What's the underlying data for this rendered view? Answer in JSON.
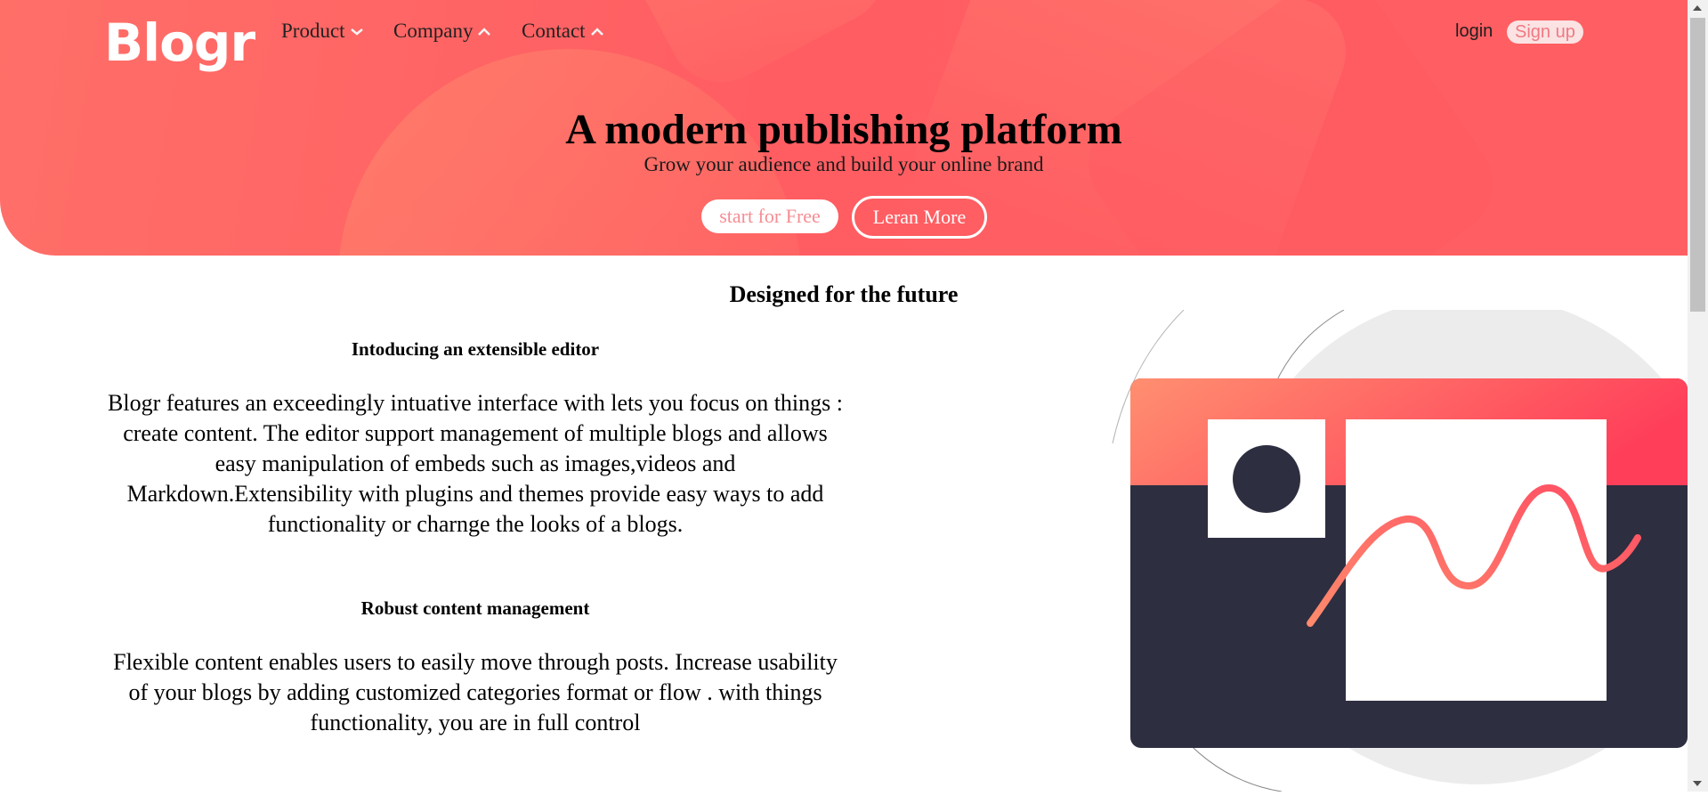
{
  "brand": {
    "logo": "Blogr"
  },
  "nav": {
    "product": "Product",
    "company": "Company",
    "contact": "Contact"
  },
  "auth": {
    "login": "login",
    "signup": "Sign up"
  },
  "hero": {
    "title": "A modern publishing platform",
    "subtitle": "Grow your audience and build your online brand",
    "primary_button": "start for Free",
    "secondary_button": "Leran More"
  },
  "section": {
    "title": "Designed for the future",
    "features": [
      {
        "heading": "Intoducing an extensible editor",
        "text": "Blogr features an exceedingly intuative interface with lets you focus on things : create content. The editor support management of multiple blogs and allows easy manipulation of embeds such as images,videos and Markdown.Extensibility with plugins and themes provide easy ways to add functionality or charnge the looks of a blogs."
      },
      {
        "heading": "Robust content management",
        "text": "Flexible content enables users to easily move through posts. Increase usability of your blogs by adding customized categories format or flow . with things functionality, you are in full control"
      }
    ]
  },
  "colors": {
    "accent": "#ff5f62",
    "dark": "#2d2e40",
    "light_accent": "#fbe2e3"
  },
  "icons": {
    "nav_product": "chevron-down-icon",
    "nav_company": "chevron-up-icon",
    "nav_contact": "chevron-up-icon"
  }
}
